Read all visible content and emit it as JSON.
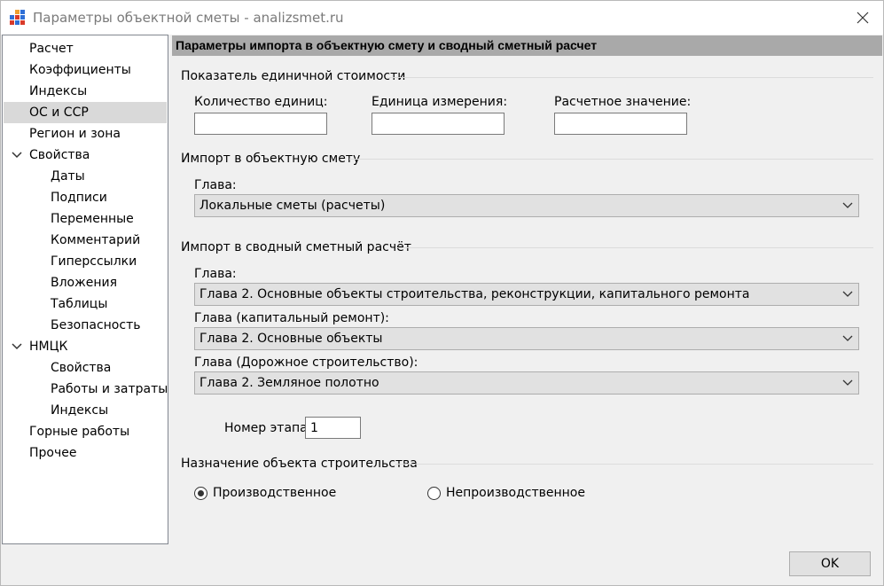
{
  "window": {
    "title": "Параметры объектной сметы - analizsmet.ru"
  },
  "sidebar": {
    "items": [
      {
        "label": "Расчет"
      },
      {
        "label": "Коэффициенты"
      },
      {
        "label": "Индексы"
      },
      {
        "label": "ОС и ССР"
      },
      {
        "label": "Регион и зона"
      },
      {
        "label": "Свойства"
      },
      {
        "label": "Даты"
      },
      {
        "label": "Подписи"
      },
      {
        "label": "Переменные"
      },
      {
        "label": "Комментарий"
      },
      {
        "label": "Гиперссылки"
      },
      {
        "label": "Вложения"
      },
      {
        "label": "Таблицы"
      },
      {
        "label": "Безопасность"
      },
      {
        "label": "НМЦК"
      },
      {
        "label": "Свойства"
      },
      {
        "label": "Работы и затраты"
      },
      {
        "label": "Индексы"
      },
      {
        "label": "Горные работы"
      },
      {
        "label": "Прочее"
      }
    ]
  },
  "main": {
    "header": "Параметры импорта в объектную смету и сводный сметный расчет",
    "unit_cost": {
      "title": "Показатель единичной стоимости",
      "quantity_label": "Количество единиц:",
      "quantity_value": "",
      "unit_label": "Единица измерения:",
      "unit_value": "",
      "calc_label": "Расчетное значение:",
      "calc_value": ""
    },
    "object_estimate": {
      "title": "Импорт в объектную смету",
      "chapter_label": "Глава:",
      "chapter_value": "Локальные сметы (расчеты)"
    },
    "summary_estimate": {
      "title": "Импорт в сводный сметный расчёт",
      "chapter_label": "Глава:",
      "chapter_value": "Глава 2. Основные объекты строительства, реконструкции, капитального ремонта",
      "capital_label": "Глава (капитальный ремонт):",
      "capital_value": "Глава 2. Основные объекты",
      "road_label": "Глава (Дорожное строительство):",
      "road_value": "Глава 2. Земляное полотно",
      "stage_label": "Номер этапа:",
      "stage_value": "1"
    },
    "purpose": {
      "title": "Назначение объекта строительства",
      "option_production": "Производственное",
      "option_nonproduction": "Непроизводственное",
      "selected": "Производственное"
    }
  },
  "footer": {
    "ok_label": "OK"
  }
}
